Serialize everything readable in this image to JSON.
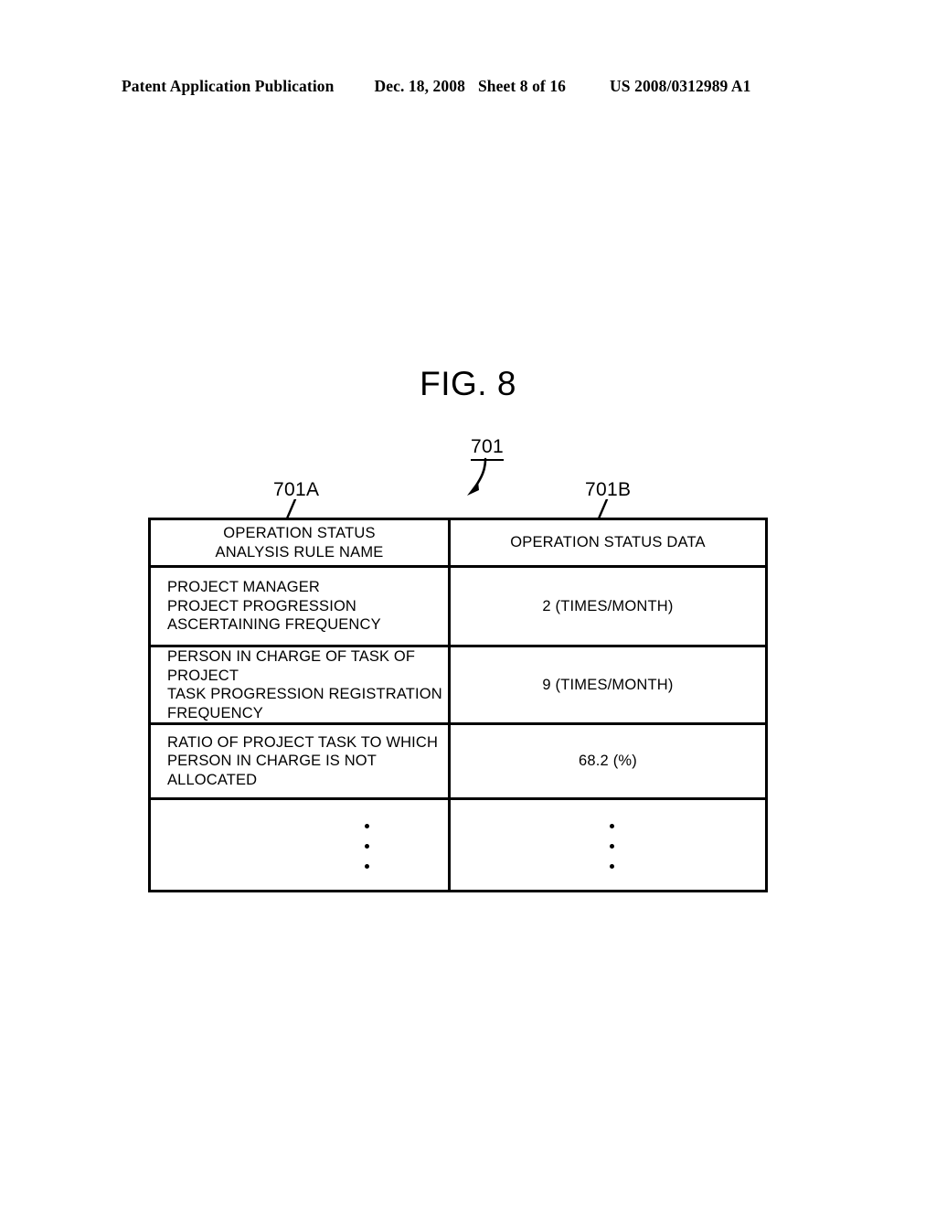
{
  "header": {
    "publication": "Patent Application Publication",
    "date": "Dec. 18, 2008",
    "sheet": "Sheet 8 of 16",
    "patent_number": "US 2008/0312989 A1"
  },
  "figure": {
    "title": "FIG. 8",
    "reference_numerals": {
      "table": "701",
      "column_left": "701A",
      "column_right": "701B"
    }
  },
  "table": {
    "columns": [
      {
        "header_line_1": "OPERATION STATUS",
        "header_line_2": "ANALYSIS RULE NAME"
      },
      {
        "header_line_1": "OPERATION STATUS DATA",
        "header_line_2": ""
      }
    ],
    "rows": [
      {
        "name_lines": [
          "PROJECT MANAGER",
          "PROJECT PROGRESSION",
          "ASCERTAINING FREQUENCY"
        ],
        "value": "2 (TIMES/MONTH)"
      },
      {
        "name_lines": [
          "PERSON IN CHARGE OF TASK OF",
          "PROJECT",
          "TASK PROGRESSION REGISTRATION",
          "FREQUENCY"
        ],
        "value": "9 (TIMES/MONTH)"
      },
      {
        "name_lines": [
          "RATIO OF PROJECT TASK TO WHICH",
          "PERSON IN CHARGE IS NOT",
          "ALLOCATED"
        ],
        "value": "68.2 (%)"
      }
    ],
    "continuation_row": {
      "name_ellipsis": "vertical-ellipsis",
      "value_ellipsis": "vertical-ellipsis"
    }
  },
  "colors": {
    "ink": "#000000",
    "page": "#ffffff"
  }
}
